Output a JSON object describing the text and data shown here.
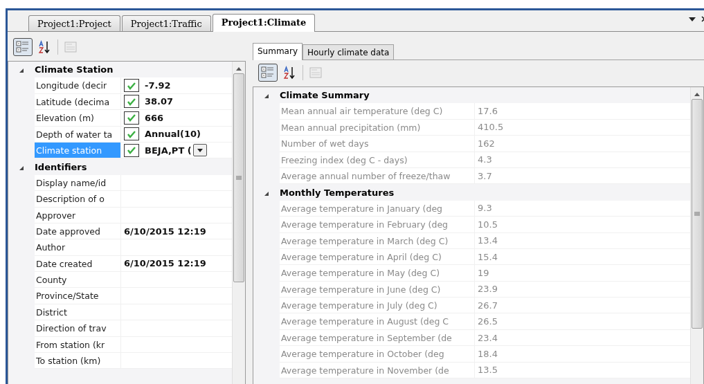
{
  "doc_tabs": [
    {
      "label": "Project1:Project",
      "selected": false
    },
    {
      "label": "Project1:Traffic",
      "selected": false
    },
    {
      "label": "Project1:Climate",
      "selected": true
    }
  ],
  "left_grid": {
    "categories": [
      {
        "title": "Climate Station",
        "expanded": true,
        "rows": [
          {
            "kind": "check",
            "label": "Longitude (decir",
            "value": "-7.92",
            "checked": true,
            "selected": false
          },
          {
            "kind": "check",
            "label": "Latitude (decima",
            "value": "38.07",
            "checked": true,
            "selected": false
          },
          {
            "kind": "check",
            "label": "Elevation (m)",
            "value": "666",
            "checked": true,
            "selected": false
          },
          {
            "kind": "check",
            "label": "Depth of water ta",
            "value": "Annual(10)",
            "checked": true,
            "selected": false
          },
          {
            "kind": "dropdown",
            "label": "Climate station",
            "value": "BEJA,PT (",
            "checked": true,
            "selected": true
          }
        ]
      },
      {
        "title": "Identifiers",
        "expanded": true,
        "rows": [
          {
            "kind": "text",
            "label": "Display name/id",
            "selected": false
          },
          {
            "kind": "text",
            "label": "Description of o",
            "selected": false
          },
          {
            "kind": "text",
            "label": "Approver",
            "selected": false
          },
          {
            "kind": "text",
            "label": "Date approved",
            "value": "6/10/2015 12:19",
            "selected": false
          },
          {
            "kind": "text",
            "label": "Author",
            "selected": false
          },
          {
            "kind": "text",
            "label": "Date created",
            "value": "6/10/2015 12:19",
            "selected": false
          },
          {
            "kind": "text",
            "label": "County",
            "selected": false
          },
          {
            "kind": "text",
            "label": "Province/State",
            "selected": false
          },
          {
            "kind": "text",
            "label": "District",
            "selected": false
          },
          {
            "kind": "text",
            "label": "Direction of trav",
            "selected": false
          },
          {
            "kind": "text",
            "label": "From station (kr",
            "selected": false
          },
          {
            "kind": "text",
            "label": "To station (km)",
            "selected": false
          }
        ]
      }
    ]
  },
  "sub_tabs": [
    {
      "label": "Summary",
      "selected": true
    },
    {
      "label": "Hourly climate data",
      "selected": false
    }
  ],
  "right_grid": {
    "categories": [
      {
        "title": "Climate Summary",
        "expanded": true,
        "rows": [
          {
            "label": "Mean annual air temperature (deg C)",
            "value": "17.6"
          },
          {
            "label": "Mean annual precipitation (mm)",
            "value": "410.5"
          },
          {
            "label": "Number of wet days",
            "value": "162"
          },
          {
            "label": "Freezing index (deg C - days)",
            "value": "4.3"
          },
          {
            "label": "Average annual number of freeze/thaw",
            "value": "3.7"
          }
        ]
      },
      {
        "title": "Monthly Temperatures",
        "expanded": true,
        "rows": [
          {
            "label": "Average temperature in January (deg",
            "value": "9.3"
          },
          {
            "label": "Average temperature in February (deg",
            "value": "10.5"
          },
          {
            "label": "Average temperature in March (deg C)",
            "value": "13.4"
          },
          {
            "label": "Average temperature in April (deg C)",
            "value": "15.4"
          },
          {
            "label": "Average temperature in May (deg C)",
            "value": "19"
          },
          {
            "label": "Average temperature in June (deg C)",
            "value": "23.9"
          },
          {
            "label": "Average temperature in July (deg C)",
            "value": "26.7"
          },
          {
            "label": "Average temperature in August (deg C",
            "value": "26.5"
          },
          {
            "label": "Average temperature in September (de",
            "value": "23.4"
          },
          {
            "label": "Average temperature in October (deg",
            "value": "18.4"
          },
          {
            "label": "Average temperature in November (de",
            "value": "13.5"
          }
        ]
      }
    ]
  }
}
